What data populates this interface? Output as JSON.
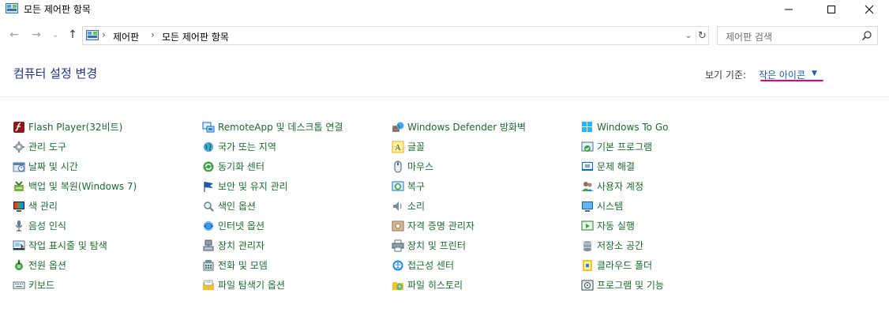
{
  "window": {
    "title": "모든 제어판 항목",
    "controls": {
      "minimize": "–",
      "maximize": "□",
      "close": "✕"
    }
  },
  "navigation": {
    "back_icon": "←",
    "forward_icon": "→",
    "history_icon": "⌄",
    "up_icon": "↑",
    "breadcrumb": [
      "제어판",
      "모든 제어판 항목"
    ],
    "separator": "›",
    "dropdown_icon": "⌄",
    "refresh_icon": "↻"
  },
  "search": {
    "placeholder": "제어판 검색"
  },
  "header": {
    "title": "컴퓨터 설정 변경",
    "view_by_label": "보기 기준:",
    "view_by_value": "작은 아이콘",
    "view_by_arrow": "▼"
  },
  "columns": [
    [
      {
        "label": "Flash Player(32비트)",
        "icon": "flash-icon"
      },
      {
        "label": "관리 도구",
        "icon": "admin-tools-icon"
      },
      {
        "label": "날짜 및 시간",
        "icon": "clock-icon"
      },
      {
        "label": "백업 및 복원(Windows 7)",
        "icon": "backup-icon"
      },
      {
        "label": "색 관리",
        "icon": "color-management-icon"
      },
      {
        "label": "음성 인식",
        "icon": "microphone-icon"
      },
      {
        "label": "작업 표시줄 및 탐색",
        "icon": "taskbar-icon"
      },
      {
        "label": "전원 옵션",
        "icon": "power-icon"
      },
      {
        "label": "키보드",
        "icon": "keyboard-icon"
      }
    ],
    [
      {
        "label": "RemoteApp 및 데스크톱 연결",
        "icon": "remoteapp-icon"
      },
      {
        "label": "국가 또는 지역",
        "icon": "globe-icon"
      },
      {
        "label": "동기화 센터",
        "icon": "sync-icon"
      },
      {
        "label": "보안 및 유지 관리",
        "icon": "flag-icon"
      },
      {
        "label": "색인 옵션",
        "icon": "indexing-icon"
      },
      {
        "label": "인터넷 옵션",
        "icon": "internet-icon"
      },
      {
        "label": "장치 관리자",
        "icon": "device-manager-icon"
      },
      {
        "label": "전화 및 모뎀",
        "icon": "phone-icon"
      },
      {
        "label": "파일 탐색기 옵션",
        "icon": "folder-options-icon"
      }
    ],
    [
      {
        "label": "Windows Defender 방화벽",
        "icon": "firewall-icon"
      },
      {
        "label": "글꼴",
        "icon": "font-icon"
      },
      {
        "label": "마우스",
        "icon": "mouse-icon"
      },
      {
        "label": "복구",
        "icon": "recovery-icon"
      },
      {
        "label": "소리",
        "icon": "speaker-icon"
      },
      {
        "label": "자격 증명 관리자",
        "icon": "credential-icon"
      },
      {
        "label": "장치 및 프린터",
        "icon": "printer-icon"
      },
      {
        "label": "접근성 센터",
        "icon": "accessibility-icon"
      },
      {
        "label": "파일 히스토리",
        "icon": "file-history-icon"
      }
    ],
    [
      {
        "label": "Windows To Go",
        "icon": "windows-to-go-icon"
      },
      {
        "label": "기본 프로그램",
        "icon": "default-programs-icon"
      },
      {
        "label": "문제 해결",
        "icon": "troubleshoot-icon"
      },
      {
        "label": "사용자 계정",
        "icon": "user-accounts-icon"
      },
      {
        "label": "시스템",
        "icon": "system-icon"
      },
      {
        "label": "자동 실행",
        "icon": "autoplay-icon"
      },
      {
        "label": "저장소 공간",
        "icon": "storage-icon"
      },
      {
        "label": "클라우드 폴더",
        "icon": "work-folders-icon"
      },
      {
        "label": "프로그램 및 기능",
        "icon": "programs-icon"
      }
    ]
  ],
  "colors": {
    "item_text": "#1a6b2e",
    "title_text": "#1e3287",
    "link_text": "#1e5aa8",
    "underline": "#e3007a"
  }
}
